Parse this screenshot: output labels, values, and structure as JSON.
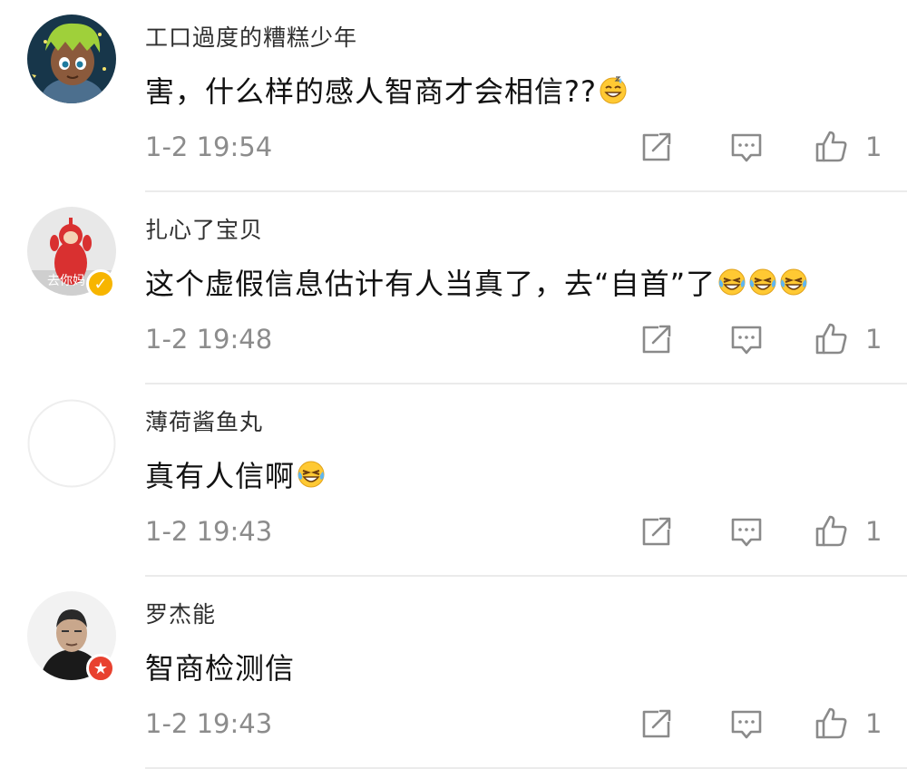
{
  "comments": [
    {
      "username": "工口過度的糟糕少年",
      "text": "害，什么样的感人智商才会相信??",
      "emojis": [
        "grin-sweat"
      ],
      "time": "1-2 19:54",
      "likes": "1",
      "badge": null
    },
    {
      "username": "扎心了宝贝",
      "text": "这个虚假信息估计有人当真了，去“自首”了",
      "emojis": [
        "laugh-cry",
        "laugh-cry",
        "laugh-cry"
      ],
      "time": "1-2 19:48",
      "likes": "1",
      "badge": "verified-yellow",
      "avatar_caption": "去你妈"
    },
    {
      "username": "薄荷酱鱼丸",
      "text": "真有人信啊",
      "emojis": [
        "laugh-cry"
      ],
      "time": "1-2 19:43",
      "likes": "1",
      "badge": null
    },
    {
      "username": "罗杰能",
      "text": "智商检测信",
      "emojis": [],
      "time": "1-2 19:43",
      "likes": "1",
      "badge": "verified-red"
    }
  ],
  "colors": {
    "text": "#111111",
    "username": "#2f2f2f",
    "meta": "#8c8c8c",
    "icon": "#8a8a8a",
    "divider": "#ebebeb",
    "badge_yellow": "#f7b500",
    "badge_red": "#e8412f"
  },
  "icons": [
    "share-icon",
    "comment-icon",
    "like-icon"
  ]
}
